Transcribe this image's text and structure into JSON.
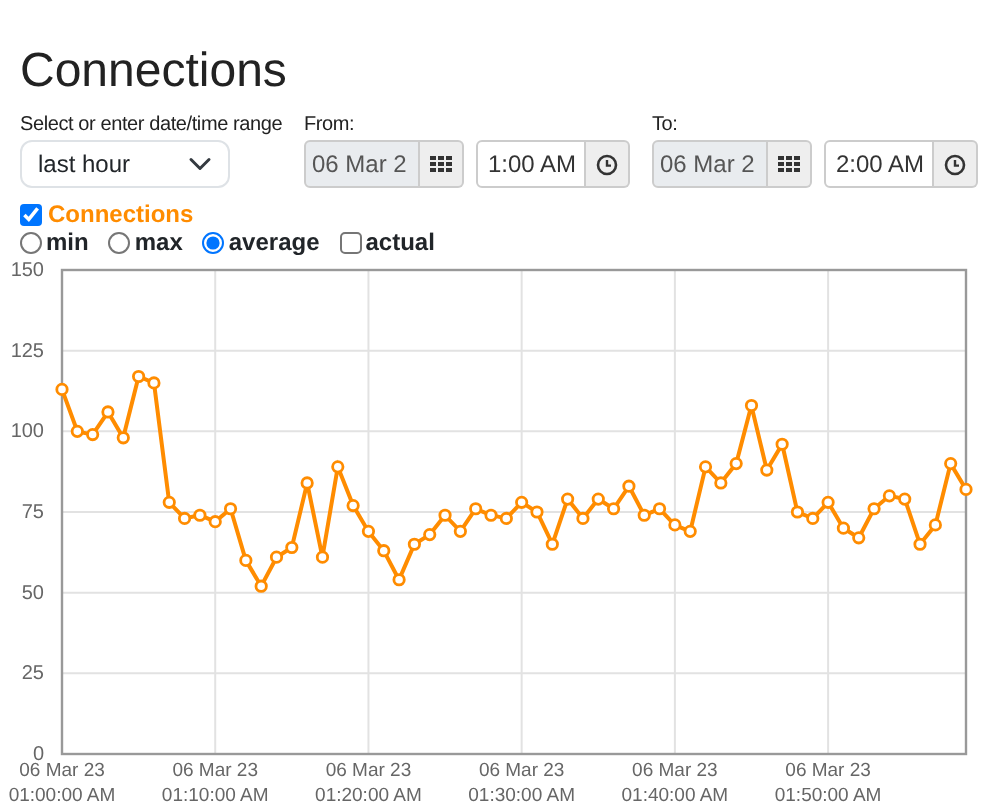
{
  "title": "Connections",
  "range": {
    "label": "Select or enter date/time range",
    "value": "last hour"
  },
  "from": {
    "label": "From:",
    "date": "06 Mar 2",
    "time": "1:00 AM"
  },
  "to": {
    "label": "To:",
    "date": "06 Mar 2",
    "time": "2:00 AM"
  },
  "series_toggle": {
    "checked": true
  },
  "modes": [
    {
      "kind": "radio",
      "label": "min",
      "selected": false
    },
    {
      "kind": "radio",
      "label": "max",
      "selected": false
    },
    {
      "kind": "radio",
      "label": "average",
      "selected": true
    },
    {
      "kind": "checkbox",
      "label": "actual",
      "selected": false
    }
  ],
  "chart": {
    "chart_data": {
      "type": "line",
      "categories": [
        "06 Mar 23\n01:00:00 AM",
        null,
        null,
        null,
        null,
        null,
        null,
        null,
        null,
        null,
        "06 Mar 23\n01:10:00 AM",
        null,
        null,
        null,
        null,
        null,
        null,
        null,
        null,
        null,
        "06 Mar 23\n01:20:00 AM",
        null,
        null,
        null,
        null,
        null,
        null,
        null,
        null,
        null,
        "06 Mar 23\n01:30:00 AM",
        null,
        null,
        null,
        null,
        null,
        null,
        null,
        null,
        null,
        "06 Mar 23\n01:40:00 AM",
        null,
        null,
        null,
        null,
        null,
        null,
        null,
        null,
        null,
        "06 Mar 23\n01:50:00 AM",
        null,
        null,
        null,
        null,
        null,
        null,
        null,
        null,
        null
      ],
      "grid": true,
      "series": [
        {
          "name": "Connections",
          "color": "#ff8c00",
          "marker": true,
          "values": [
            113,
            100,
            99,
            106,
            98,
            117,
            115,
            78,
            73,
            74,
            72,
            76,
            60,
            52,
            61,
            64,
            84,
            61,
            89,
            77,
            69,
            63,
            54,
            65,
            68,
            74,
            69,
            76,
            74,
            73,
            78,
            75,
            65,
            79,
            73,
            79,
            76,
            83,
            74,
            76,
            71,
            69,
            89,
            84,
            90,
            108,
            88,
            96,
            75,
            73,
            78,
            70,
            67,
            76,
            80,
            79,
            65,
            71,
            90,
            82
          ]
        }
      ],
      "ylim": [
        0,
        150
      ],
      "yticks": [
        0,
        25,
        50,
        75,
        100,
        125,
        150
      ]
    }
  }
}
